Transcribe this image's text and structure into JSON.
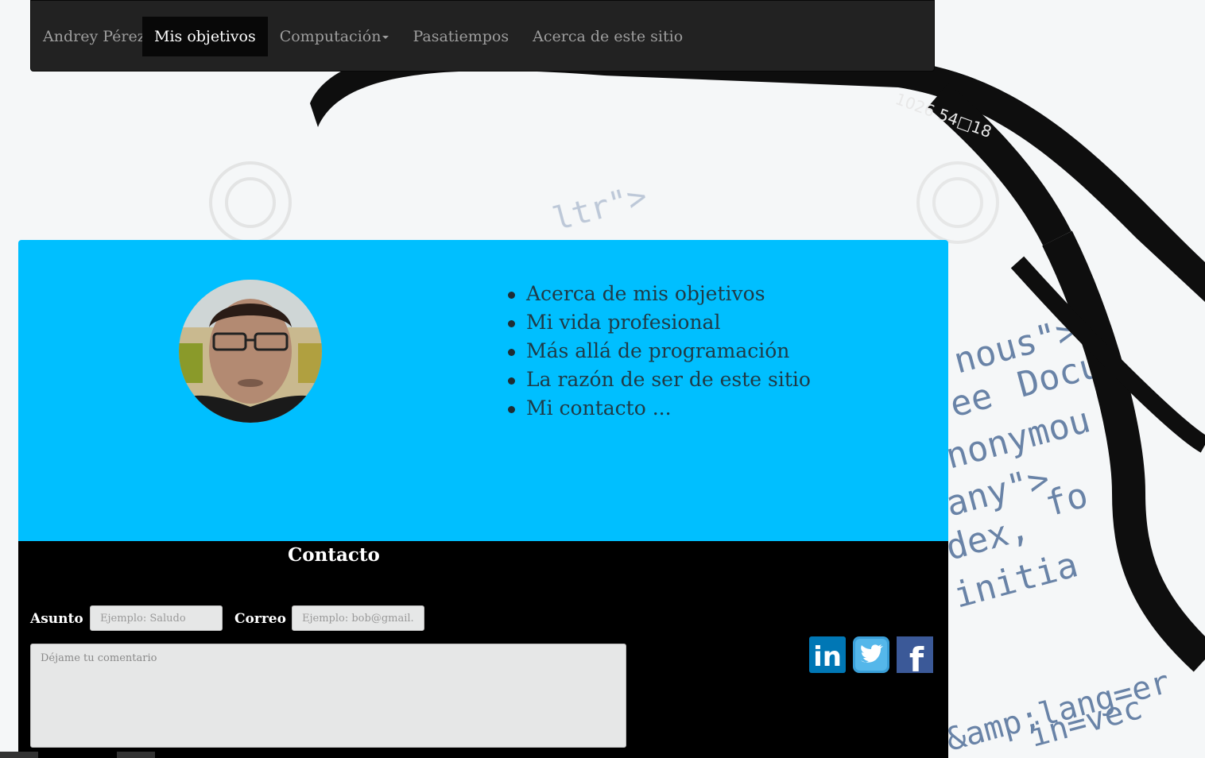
{
  "navbar": {
    "brand": "Andrey Pérez",
    "items": [
      {
        "label": "Mis objetivos",
        "active": true
      },
      {
        "label": "Computación",
        "dropdown": true
      },
      {
        "label": "Pasatiempos"
      },
      {
        "label": "Acerca de este sitio"
      }
    ]
  },
  "profile": {
    "objectives": [
      "Acerca de mis objetivos",
      "Mi vida profesional",
      "Más allá de programación",
      "La razón de ser de este sitio",
      "Mi contacto ..."
    ]
  },
  "contact": {
    "title": "Contacto",
    "subject_label": "Asunto",
    "subject_placeholder": "Ejemplo: Saludo",
    "email_label": "Correo",
    "email_placeholder": "Ejemplo: bob@gmail.cc",
    "comment_placeholder": "Déjame tu comentario"
  },
  "social": [
    {
      "icon": "linkedin-icon",
      "text": "in",
      "color": "#0077b5"
    },
    {
      "icon": "twitter-icon",
      "color": "#3a9fd8"
    },
    {
      "icon": "facebook-icon",
      "text": "f",
      "color": "#3b5998"
    }
  ],
  "colors": {
    "navbar_bg": "#222222",
    "panel_bg": "#00bfff",
    "contact_bg": "#000000"
  }
}
